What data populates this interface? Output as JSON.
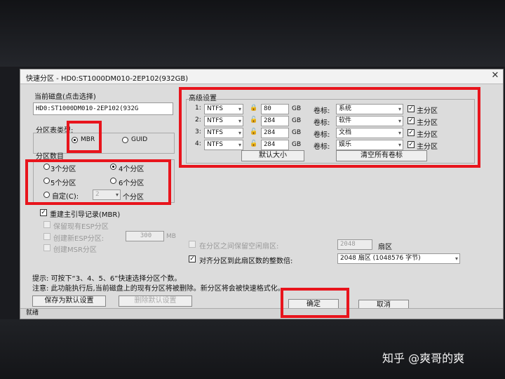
{
  "window": {
    "title": "快速分区 - HD0:ST1000DM010-2EP102(932GB)"
  },
  "disk": {
    "label": "当前磁盘(点击选择)",
    "value": "HD0:ST1000DM010-2EP102(932G"
  },
  "partition_table": {
    "label": "分区表类型:",
    "mbr": "MBR",
    "guid": "GUID",
    "selected": "MBR"
  },
  "partition_count": {
    "label": "分区数目",
    "options": [
      "3个分区",
      "4个分区",
      "5个分区",
      "6个分区"
    ],
    "selected": "4个分区",
    "custom_label": "自定(C):",
    "custom_value": "2",
    "custom_suffix": "个分区"
  },
  "options": {
    "rebuild_mbr": "重建主引导记录(MBR)",
    "keep_esp": "保留现有ESP分区",
    "create_esp": "创建新ESP分区:",
    "esp_size": "300",
    "esp_unit": "MB",
    "create_msr": "创建MSR分区"
  },
  "advanced": {
    "title": "高级设置",
    "gb": "GB",
    "volume_label": "卷标:",
    "primary_label": "主分区",
    "rows": [
      {
        "num": "1:",
        "fs": "NTFS",
        "size": "80",
        "label": "系统",
        "primary": true
      },
      {
        "num": "2:",
        "fs": "NTFS",
        "size": "284",
        "label": "软件",
        "primary": true
      },
      {
        "num": "3:",
        "fs": "NTFS",
        "size": "284",
        "label": "文档",
        "primary": true
      },
      {
        "num": "4:",
        "fs": "NTFS",
        "size": "284",
        "label": "娱乐",
        "primary": true
      }
    ],
    "default_size_button": "默认大小",
    "clear_labels_button": "清空所有卷标"
  },
  "alignment": {
    "reserve_label": "在分区之间保留空闲扇区:",
    "reserve_value": "2048",
    "reserve_unit": "扇区",
    "align_label": "对齐分区到此扇区数的整数倍:",
    "align_value": "2048 扇区 (1048576 字节)"
  },
  "hints": {
    "tip": "提示: 可按下“3、4、5、6”快速选择分区个数。",
    "note": "注意: 此功能执行后,当前磁盘上的现有分区将被删除。新分区将会被快速格式化。"
  },
  "buttons": {
    "save_default": "保存为默认设置",
    "delete_default": "删除默认设置",
    "ok": "确定",
    "cancel": "取消"
  },
  "status": "就绪",
  "watermark": "知乎 @爽哥的爽",
  "colors": {
    "highlight": "#e8141c",
    "dialog_bg": "#dcdcdc"
  }
}
